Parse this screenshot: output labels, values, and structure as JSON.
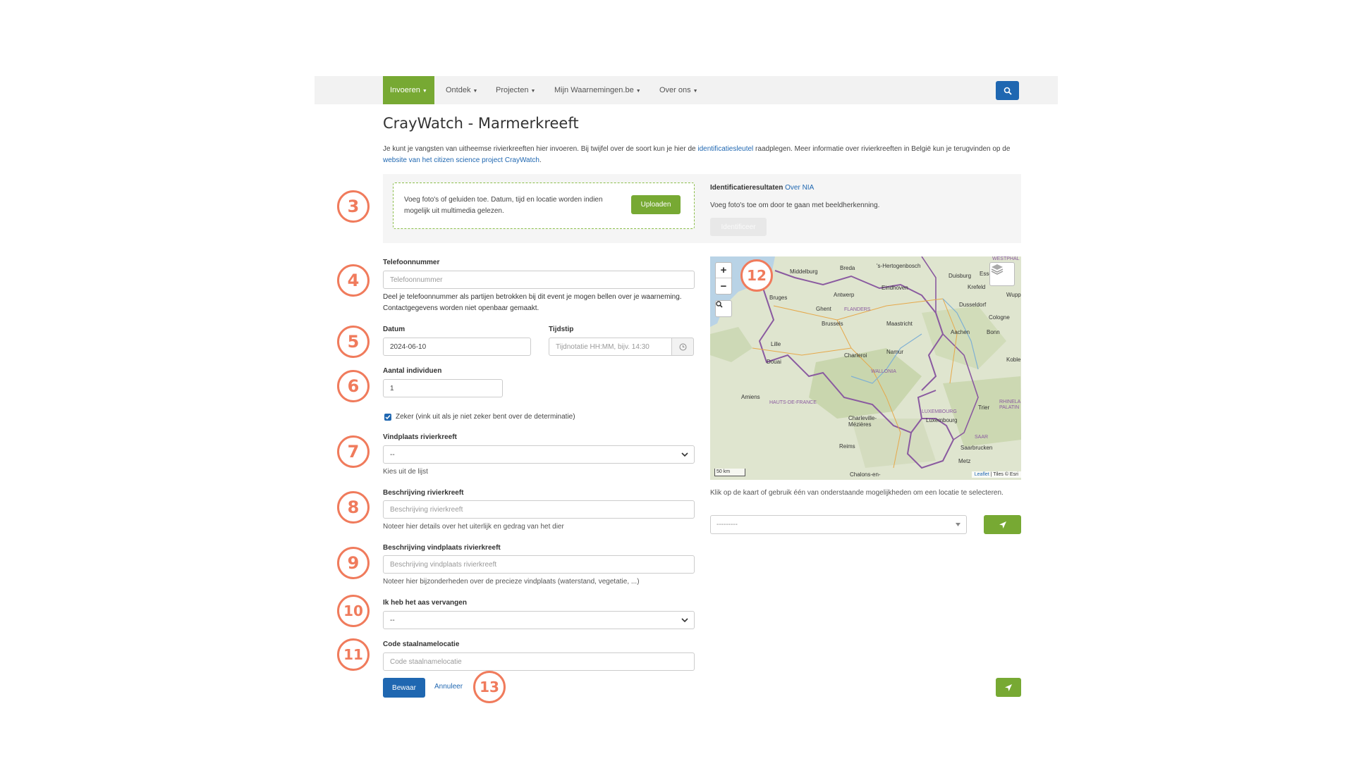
{
  "nav": {
    "items": [
      {
        "label": "Invoeren"
      },
      {
        "label": "Ontdek"
      },
      {
        "label": "Projecten"
      },
      {
        "label": "Mijn Waarnemingen.be"
      },
      {
        "label": "Over ons"
      }
    ]
  },
  "page": {
    "title": "CrayWatch - Marmerkreeft",
    "intro_1": "Je kunt je vangsten van uitheemse rivierkreeften hier invoeren. Bij twijfel over de soort kun je hier de ",
    "intro_link_1": "identificatiesleutel",
    "intro_2": " raadplegen. Meer informatie over rivierkreeften in België kun je terugvinden op de ",
    "intro_link_2": "website van het citizen science project CrayWatch",
    "intro_3": "."
  },
  "upload": {
    "text": "Voeg foto's of geluiden toe. Datum, tijd en locatie worden indien mogelijk uit multimedia gelezen.",
    "button": "Uploaden",
    "nia_title": "Identificatieresultaten",
    "nia_link": "Over NIA",
    "nia_text": "Voeg foto's toe om door te gaan met beeldherkenning.",
    "identify_button": "Identificeer"
  },
  "form": {
    "phone_label": "Telefoonnummer",
    "phone_placeholder": "Telefoonnummer",
    "phone_help": "Deel je telefoonnummer als partijen betrokken bij dit event je mogen bellen over je waarneming. Contactgegevens worden niet openbaar gemaakt.",
    "date_label": "Datum",
    "date_value": "2024-06-10",
    "time_label": "Tijdstip",
    "time_placeholder": "Tijdnotatie HH:MM, bijv. 14:30",
    "count_label": "Aantal individuen",
    "count_value": "1",
    "sure_label": "Zeker (vink uit als je niet zeker bent over de determinatie)",
    "site_label": "Vindplaats rivierkreeft",
    "site_value": "--",
    "site_help": "Kies uit de lijst",
    "desc_label": "Beschrijving rivierkreeft",
    "desc_placeholder": "Beschrijving rivierkreeft",
    "desc_help": "Noteer hier details over het uiterlijk en gedrag van het dier",
    "site_desc_label": "Beschrijving vindplaats rivierkreeft",
    "site_desc_placeholder": "Beschrijving vindplaats rivierkreeft",
    "site_desc_help": "Noteer hier bijzonderheden over de precieze vindplaats (waterstand, vegetatie, ...)",
    "bait_label": "Ik heb het aas vervangen",
    "bait_value": "--",
    "code_label": "Code staalnamelocatie",
    "code_placeholder": "Code staalnamelocatie",
    "save": "Bewaar",
    "cancel": "Annuleer"
  },
  "map": {
    "cities": [
      "Breda",
      "'s-Hertogenbosch",
      "Middelburg",
      "Duisburg",
      "Essen",
      "Eindhoven",
      "Krefeld",
      "Wupp",
      "Bruges",
      "Antwerp",
      "Dusseldorf",
      "Ghent",
      "FLANDERS",
      "Brussels",
      "Maastricht",
      "Cologne",
      "Aachen",
      "Bonn",
      "Lille",
      "Namur",
      "Charleroi",
      "Koblen",
      "Douai",
      "WALLONIA",
      "Amiens",
      "HAUTS-DE-FRANCE",
      "Trier",
      "LUXEMBOURG",
      "Luxembourg",
      "Charleville-Mézières",
      "Reims",
      "Saarbrucken",
      "Metz",
      "Chalons-en-",
      "WESTPHAL",
      "RHINELA PALATIN",
      "SAAR"
    ],
    "scale": "50 km",
    "attribution_link": "Leaflet",
    "attribution_text": " | Tiles © Esri",
    "help": "Klik op de kaart of gebruik één van onderstaande mogelijkheden om een locatie te selecteren.",
    "location_value": "---------"
  },
  "annotations": [
    "3",
    "4",
    "5",
    "6",
    "7",
    "8",
    "9",
    "10",
    "11",
    "12",
    "13"
  ],
  "colors": {
    "accent_green": "#77a933",
    "primary_blue": "#1f67b1",
    "annotation": "#f07b5c"
  }
}
